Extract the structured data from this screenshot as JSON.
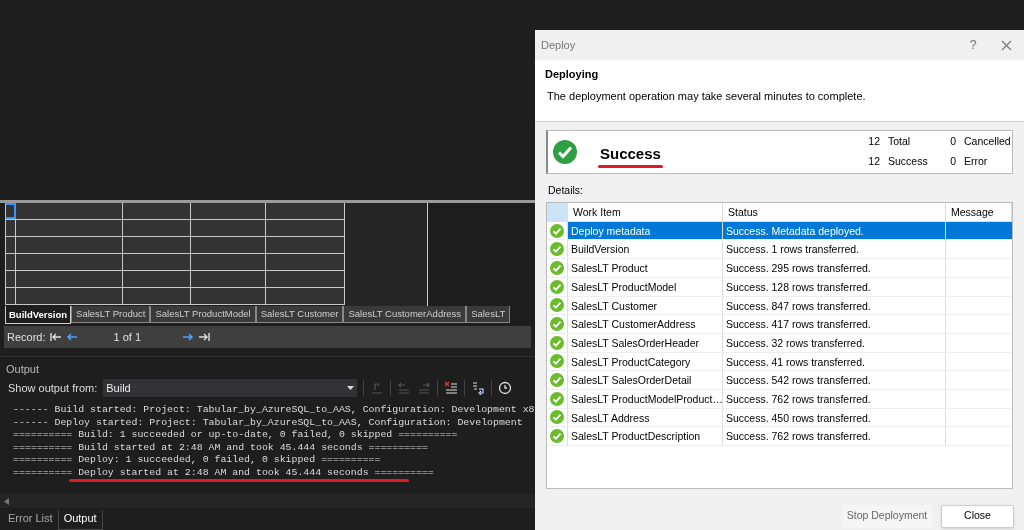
{
  "grid": {
    "rows": [
      [
        {
          "selected": true
        },
        {
          "selected": false
        },
        {
          "selected": false
        },
        {
          "selected": false
        },
        {
          "selected": false
        }
      ],
      [
        {
          "selected": false
        },
        {
          "selected": false
        },
        {
          "selected": false
        },
        {
          "selected": false
        },
        {
          "selected": false
        }
      ],
      [
        {
          "selected": false
        },
        {
          "selected": false
        },
        {
          "selected": false
        },
        {
          "selected": false
        },
        {
          "selected": false
        }
      ],
      [
        {
          "selected": false
        },
        {
          "selected": false
        },
        {
          "selected": false
        },
        {
          "selected": false
        },
        {
          "selected": false
        }
      ],
      [
        {
          "selected": false
        },
        {
          "selected": false
        },
        {
          "selected": false
        },
        {
          "selected": false
        },
        {
          "selected": false
        }
      ],
      [
        {
          "selected": false
        },
        {
          "selected": false
        },
        {
          "selected": false
        },
        {
          "selected": false
        },
        {
          "selected": false
        }
      ]
    ]
  },
  "sheet_tabs": [
    {
      "label": "BuildVersion",
      "selected": true
    },
    {
      "label": "SalesLT Product",
      "selected": false
    },
    {
      "label": "SalesLT ProductModel",
      "selected": false
    },
    {
      "label": "SalesLT Customer",
      "selected": false
    },
    {
      "label": "SalesLT CustomerAddress",
      "selected": false
    },
    {
      "label": "SalesLT",
      "selected": false
    }
  ],
  "record_bar": {
    "label": "Record:",
    "position": "1 of 1"
  },
  "output": {
    "title": "Output",
    "source_label": "Show output from:",
    "source_value": "Build",
    "lines": [
      {
        "text": "------ Build started: Project: Tabular_by_AzureSQL_to_AAS, Configuration: Development x8",
        "highlighted": false
      },
      {
        "text": "------ Deploy started: Project: Tabular_by_AzureSQL_to_AAS, Configuration: Development",
        "highlighted": false
      },
      {
        "text": "========== Build: 1 succeeded or up-to-date, 0 failed, 0 skipped ==========",
        "highlighted": false
      },
      {
        "text": "========== Build started at 2:48 AM and took 45.444 seconds ==========",
        "highlighted": false
      },
      {
        "text": "========== Deploy: 1 succeeded, 0 failed, 0 skipped ==========",
        "highlighted": false
      },
      {
        "text": "========== Deploy started at 2:48 AM and took 45.444 seconds ==========",
        "highlighted": true
      }
    ]
  },
  "bottom_tabs": [
    {
      "label": "Error List",
      "selected": false
    },
    {
      "label": "Output",
      "selected": true
    }
  ],
  "dialog": {
    "title": "Deploy",
    "help": "?",
    "heading": "Deploying",
    "description": "The deployment operation may take several minutes to complete.",
    "result": "Success",
    "counts": [
      {
        "value": "12",
        "label": "Total"
      },
      {
        "value": "0",
        "label": "Cancelled"
      },
      {
        "value": "12",
        "label": "Success"
      },
      {
        "value": "0",
        "label": "Error"
      }
    ],
    "details_label": "Details:",
    "columns": [
      "Work Item",
      "Status",
      "Message"
    ],
    "rows": [
      {
        "item": "Deploy metadata",
        "status": "Success. Metadata deployed.",
        "selected": true
      },
      {
        "item": "BuildVersion",
        "status": "Success. 1 rows transferred.",
        "selected": false
      },
      {
        "item": "SalesLT Product",
        "status": "Success. 295 rows transferred.",
        "selected": false
      },
      {
        "item": "SalesLT ProductModel",
        "status": "Success. 128 rows transferred.",
        "selected": false
      },
      {
        "item": "SalesLT Customer",
        "status": "Success. 847 rows transferred.",
        "selected": false
      },
      {
        "item": "SalesLT CustomerAddress",
        "status": "Success. 417 rows transferred.",
        "selected": false
      },
      {
        "item": "SalesLT SalesOrderHeader",
        "status": "Success. 32 rows transferred.",
        "selected": false
      },
      {
        "item": "SalesLT ProductCategory",
        "status": "Success. 41 rows transferred.",
        "selected": false
      },
      {
        "item": "SalesLT SalesOrderDetail",
        "status": "Success. 542 rows transferred.",
        "selected": false
      },
      {
        "item": "SalesLT ProductModelProduct…",
        "status": "Success. 762 rows transferred.",
        "selected": false
      },
      {
        "item": "SalesLT Address",
        "status": "Success. 450 rows transferred.",
        "selected": false
      },
      {
        "item": "SalesLT ProductDescription",
        "status": "Success. 762 rows transferred.",
        "selected": false
      }
    ],
    "buttons": [
      {
        "label": "Stop Deployment",
        "disabled": true
      },
      {
        "label": "Close",
        "disabled": false
      }
    ]
  }
}
